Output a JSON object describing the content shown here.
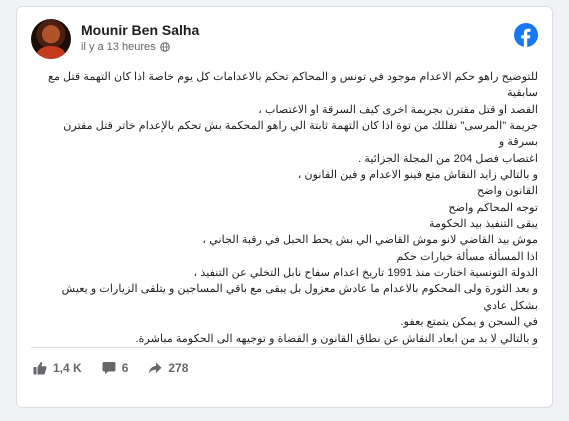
{
  "post": {
    "author": "Mounir Ben Salha",
    "time": "il y a 13 heures",
    "lines": [
      "للتوضيح راهو حكم الاعدام موجود في تونس و المحاكم تحكم بالاعدامات كل يوم خاصة اذا كان التهمة قتل مع سابقية",
      "القصد او قتل مقترن بجريمة اخرى كيف السرقة او الاغتصاب ،",
      "جريمة \"المرسى\" نفللك من توة اذا كان التهمة ثابتة الي راهو المحكمة بش تحكم بالإعدام خاتر قتل مقترن بسرقة و",
      "اغتصاب فصل 204 من المجلة الجزائية .",
      "و بالتالي زايد النقاش متع فينو الاعدام و فين القانون ،",
      "القانون واضح",
      "توجه المحاكم واضح",
      "يبقى التنفيذ بيد الحكومة",
      "موش بيد القاضي لانو موش القاضي الي بش يحط الحبل في رقبة الجاني ،",
      "اذا المسألة مسألة خيارات حكم",
      "الدولة التونسية اختارت منذ 1991 تاريخ اعدام سفاح نابل التخلي عن التنفيذ ،",
      "و بعد الثورة ولى المحكوم بالاعدام ما عادش معزول بل يبقى مع باقي المساجين و يتلقى الزيارات و يعيش بشكل عادي",
      "في السجن و يمكن يتمتع بعفو.",
      "و بالتالي لا بد من ابعاد النقاش عن نطاق القانون و القضاة و توجيهه الى الحكومة مباشرة."
    ]
  },
  "stats": {
    "likes": "1,4 K",
    "comments": "6",
    "shares": "278"
  },
  "colors": {
    "facebook_blue": "#1877f2",
    "text": "#1c1e21",
    "muted": "#65676b"
  },
  "icons": {
    "logo": "facebook-logo-icon",
    "privacy": "globe-icon",
    "like": "thumbs-up-icon",
    "comment": "comment-icon",
    "share": "share-arrow-icon"
  }
}
